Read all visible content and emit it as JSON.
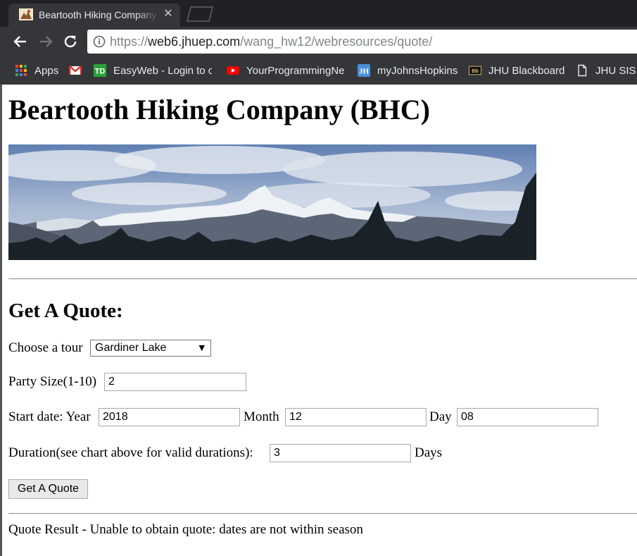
{
  "browser": {
    "tab_title": "Beartooth Hiking Company",
    "url_scheme": "https://",
    "url_host": "web6.jhuep.com",
    "url_path": "/wang_hw12/webresources/quote/",
    "bookmarks": [
      {
        "label": "Apps",
        "icon": "apps-grid-icon"
      },
      {
        "label": "",
        "icon": "gmail-icon"
      },
      {
        "label": "EasyWeb - Login to o",
        "icon": "td-icon"
      },
      {
        "label": "YourProgrammingNe",
        "icon": "youtube-icon"
      },
      {
        "label": "myJohnsHopkins",
        "icon": "jh-icon"
      },
      {
        "label": "JHU Blackboard",
        "icon": "blackboard-icon"
      },
      {
        "label": "JHU SIS",
        "icon": "document-icon"
      }
    ],
    "favicon_text": "TD",
    "jh_text": "JH",
    "bb_text": "Bb"
  },
  "page": {
    "title": "Beartooth Hiking Company (BHC)",
    "heading": "Get A Quote:",
    "tour_label": "Choose a tour",
    "tour_selected": "Gardiner Lake",
    "party_label": "Party Size(1-10)",
    "party_value": "2",
    "start_label": "Start date: Year",
    "year_value": "2018",
    "month_label": "Month",
    "month_value": "12",
    "day_label": "Day",
    "day_value": "08",
    "duration_label": "Duration(see chart above for valid durations):",
    "duration_value": "3",
    "days_label": "Days",
    "button_label": "Get A Quote",
    "result_text": "Quote Result - Unable to obtain quote: dates are not within season"
  },
  "colors": {
    "chrome_dark": "#202124",
    "chrome_toolbar": "#35363a",
    "youtube_red": "#ff0000",
    "td_green": "#2aa33a",
    "jh_blue": "#4a90d9"
  }
}
